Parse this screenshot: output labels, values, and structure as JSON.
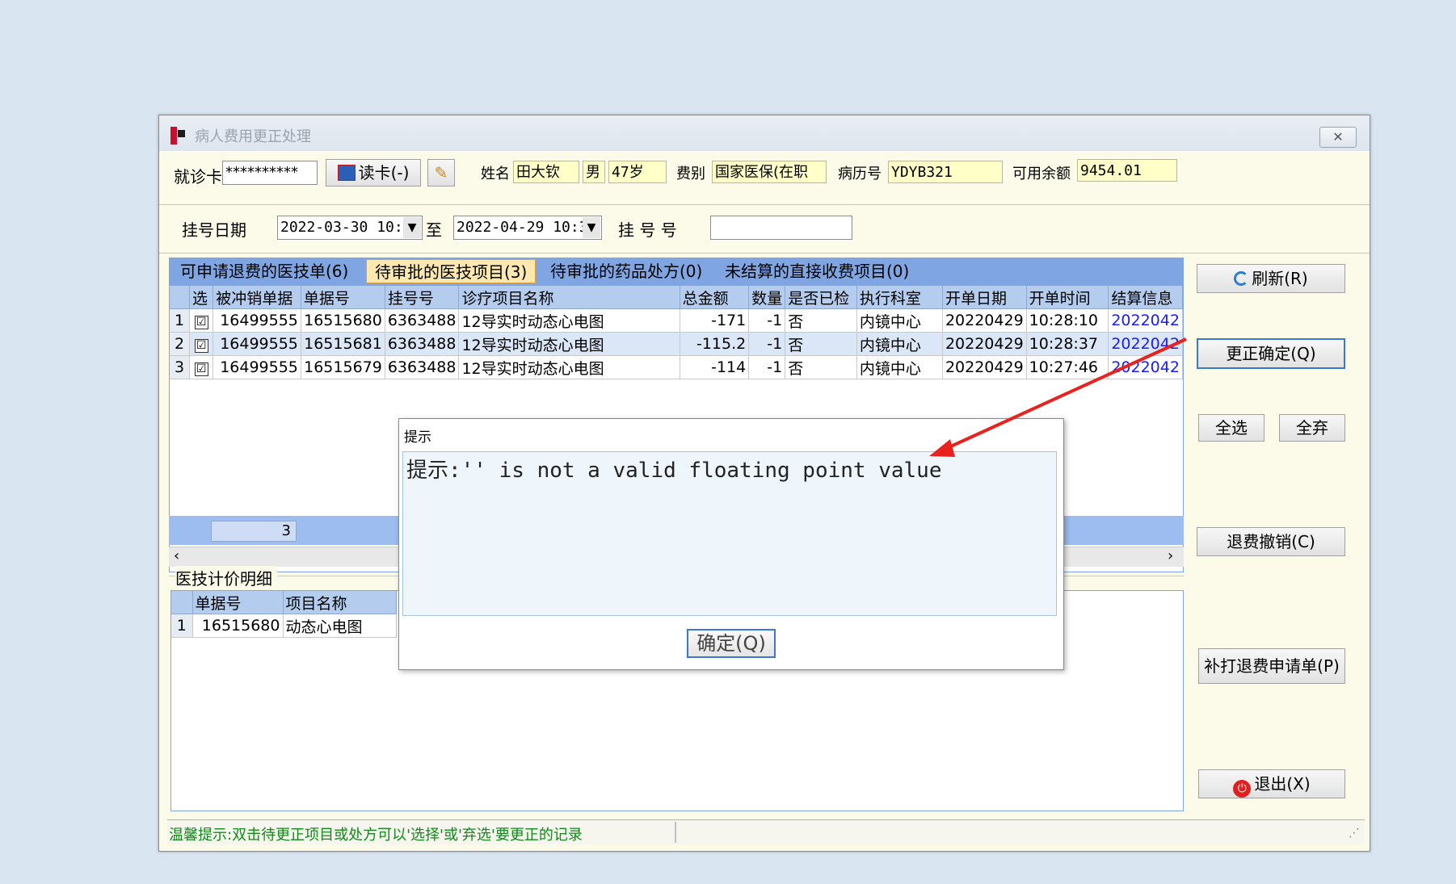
{
  "window": {
    "title": "病人费用更正处理",
    "close_symbol": "✕"
  },
  "header": {
    "card_label": "就诊卡",
    "card_value": "**********",
    "read_card_label": "读卡(-)",
    "name_label": "姓名",
    "name_value": "田大钦",
    "gender_value": "男",
    "age_value": "47岁",
    "fee_type_label": "费别",
    "fee_type_value": "国家医保(在职",
    "record_label": "病历号",
    "record_value": "YDYB321",
    "balance_label": "可用余额",
    "balance_value": "9454.01",
    "reg_date_label": "挂号日期",
    "date_from": "2022-03-30 10:",
    "to_label": "至",
    "date_to": "2022-04-29 10:3",
    "reg_no_label": "挂 号 号",
    "reg_no_value": ""
  },
  "tabs": [
    {
      "label": "可申请退费的医技单(6)"
    },
    {
      "label": "待审批的医技项目(3)"
    },
    {
      "label": "待审批的药品处方(0)"
    },
    {
      "label": "未结算的直接收费项目(0)"
    }
  ],
  "grid1": {
    "columns": [
      "选",
      "被冲销单据",
      "单据号",
      "挂号号",
      "诊疗项目名称",
      "总金额",
      "数量",
      "是否已检",
      "执行科室",
      "开单日期",
      "开单时间",
      "结算信息"
    ],
    "rows": [
      {
        "n": "1",
        "sel": "☑",
        "orig": "16499555",
        "doc": "16515680",
        "reg": "6363488",
        "item": "12导实时动态心电图",
        "amount": "-171",
        "qty": "-1",
        "checked": "否",
        "dept": "内镜中心",
        "date": "20220429",
        "time": "10:28:10",
        "settle": "2022042"
      },
      {
        "n": "2",
        "sel": "☑",
        "orig": "16499555",
        "doc": "16515681",
        "reg": "6363488",
        "item": "12导实时动态心电图",
        "amount": "-115.2",
        "qty": "-1",
        "checked": "否",
        "dept": "内镜中心",
        "date": "20220429",
        "time": "10:28:37",
        "settle": "2022042"
      },
      {
        "n": "3",
        "sel": "☑",
        "orig": "16499555",
        "doc": "16515679",
        "reg": "6363488",
        "item": "12导实时动态心电图",
        "amount": "-114",
        "qty": "-1",
        "checked": "否",
        "dept": "内镜中心",
        "date": "20220429",
        "time": "10:27:46",
        "settle": "2022042"
      }
    ],
    "footer_count": "3"
  },
  "detail": {
    "title": "医技计价明细",
    "columns": [
      "单据号",
      "项目名称"
    ],
    "rows": [
      {
        "n": "1",
        "doc": "16515680",
        "item": "动态心电图"
      }
    ]
  },
  "side_buttons": {
    "refresh": "刷新(R)",
    "confirm": "更正确定(Q)",
    "select_all": "全选",
    "deselect_all": "全弃",
    "cancel_refund": "退费撤销(C)",
    "reprint": "补打退费申请单(P)",
    "exit": "退出(X)"
  },
  "status": {
    "hint": "温馨提示:双击待更正项目或处方可以'选择'或'弃选'要更正的记录"
  },
  "dialog": {
    "title": "提示",
    "message": "提示:'' is not a valid floating point value",
    "ok_label": "确定(Q)"
  },
  "colors": {
    "accent": "#7fa6e2",
    "field_yellow": "#ffffc8",
    "arrow": "#e8231d",
    "status_green": "#0f8a1a"
  },
  "icons": {
    "refresh": "refresh-icon",
    "exit": "power-icon",
    "read_card": "card-reader-icon",
    "clear": "broom-icon"
  }
}
